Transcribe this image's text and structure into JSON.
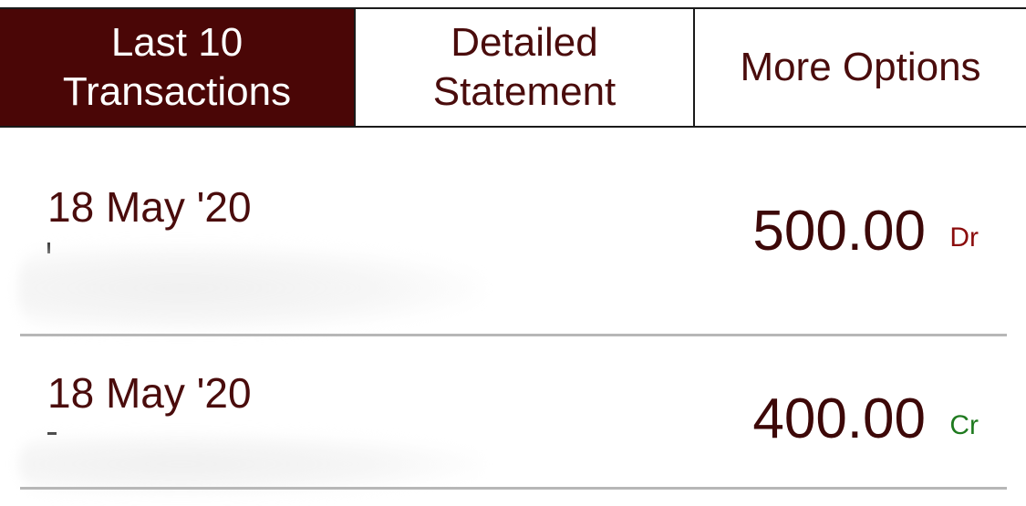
{
  "tabs": [
    {
      "label_line1": "Last 10",
      "label_line2": "Transactions",
      "active": true
    },
    {
      "label_line1": "Detailed",
      "label_line2": "Statement",
      "active": false
    },
    {
      "label_line1": "More Options",
      "label_line2": "",
      "active": false
    }
  ],
  "transactions": [
    {
      "date": "18 May '20",
      "amount": "500.00",
      "type": "Dr",
      "type_color": "#8b0d0d"
    },
    {
      "date": "18 May '20",
      "amount": "400.00",
      "type": "Cr",
      "type_color": "#1f7a1f"
    }
  ],
  "colors": {
    "accent": "#4a0606",
    "text": "#4a0c0c",
    "divider": "#b7b7b7"
  }
}
